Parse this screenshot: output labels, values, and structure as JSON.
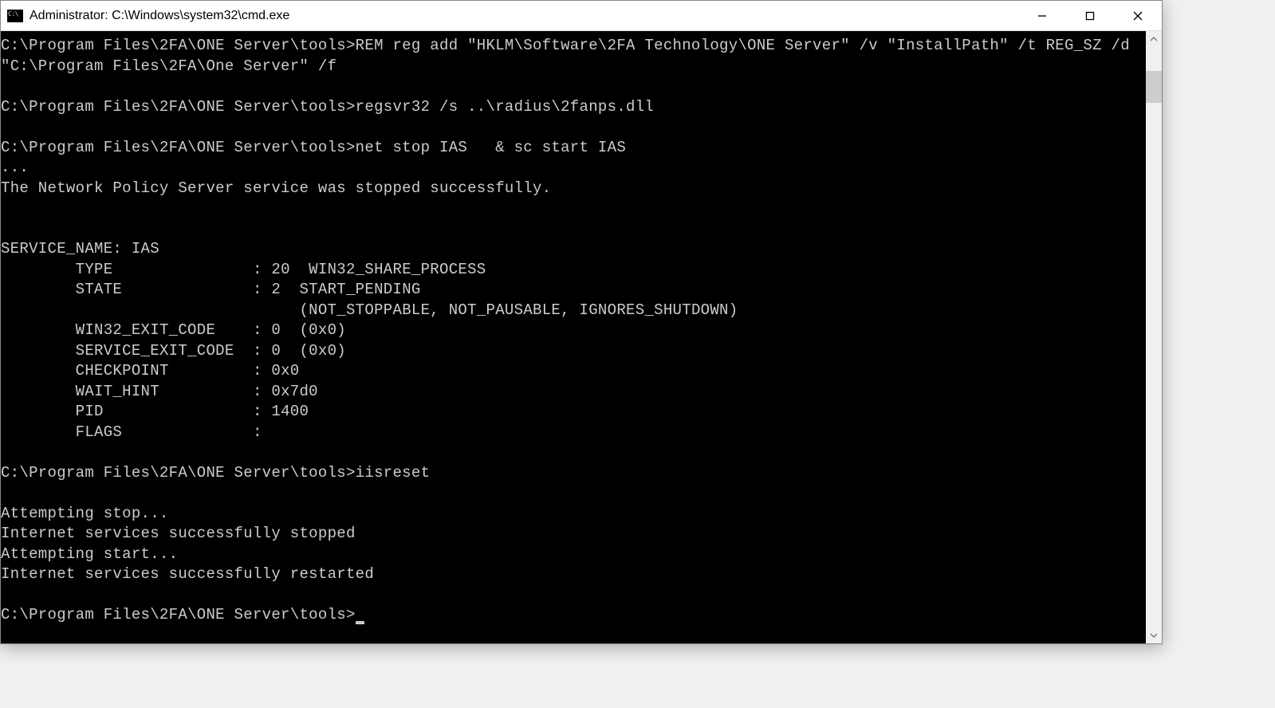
{
  "titlebar": {
    "title": "Administrator: C:\\Windows\\system32\\cmd.exe"
  },
  "console": {
    "prompt": "C:\\Program Files\\2FA\\ONE Server\\tools>",
    "lines": [
      "C:\\Program Files\\2FA\\ONE Server\\tools>REM reg add \"HKLM\\Software\\2FA Technology\\ONE Server\" /v \"InstallPath\" /t REG_SZ /d \"C:\\Program Files\\2FA\\One Server\" /f",
      "",
      "C:\\Program Files\\2FA\\ONE Server\\tools>regsvr32 /s ..\\radius\\2fanps.dll",
      "",
      "C:\\Program Files\\2FA\\ONE Server\\tools>net stop IAS   & sc start IAS",
      "...",
      "The Network Policy Server service was stopped successfully.",
      "",
      "",
      "SERVICE_NAME: IAS",
      "        TYPE               : 20  WIN32_SHARE_PROCESS",
      "        STATE              : 2  START_PENDING",
      "                                (NOT_STOPPABLE, NOT_PAUSABLE, IGNORES_SHUTDOWN)",
      "        WIN32_EXIT_CODE    : 0  (0x0)",
      "        SERVICE_EXIT_CODE  : 0  (0x0)",
      "        CHECKPOINT         : 0x0",
      "        WAIT_HINT          : 0x7d0",
      "        PID                : 1400",
      "        FLAGS              :",
      "",
      "C:\\Program Files\\2FA\\ONE Server\\tools>iisreset",
      "",
      "Attempting stop...",
      "Internet services successfully stopped",
      "Attempting start...",
      "Internet services successfully restarted",
      ""
    ],
    "current_prompt": "C:\\Program Files\\2FA\\ONE Server\\tools>"
  }
}
